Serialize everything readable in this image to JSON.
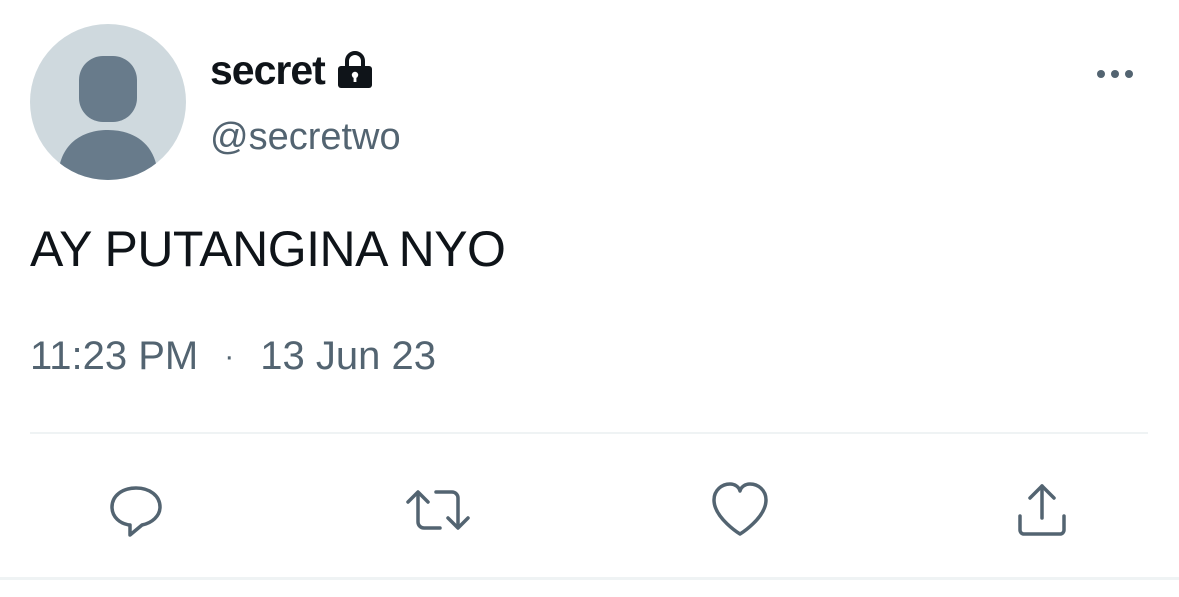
{
  "author": {
    "display_name": "secret",
    "handle": "@secretwo",
    "protected_icon": "lock-icon",
    "avatar_icon": "default-avatar-silhouette"
  },
  "tweet": {
    "text": "AY PUTANGINA NYO",
    "time": "11:23 PM",
    "separator": "·",
    "date": "13 Jun 23"
  },
  "actions": {
    "reply_icon": "reply-icon",
    "retweet_icon": "retweet-icon",
    "like_icon": "heart-icon",
    "share_icon": "share-icon",
    "more_icon": "more-options-icon"
  },
  "colors": {
    "text_primary": "#0f1419",
    "text_secondary": "#536471",
    "avatar_bg": "#cfd9de",
    "avatar_fg": "#687b8b",
    "divider": "#eff3f4"
  }
}
